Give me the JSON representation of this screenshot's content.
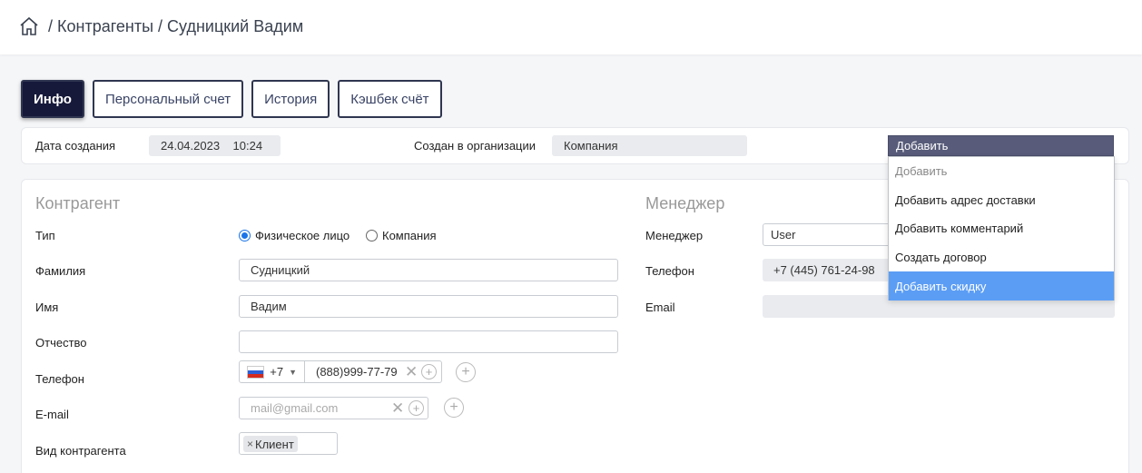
{
  "breadcrumb": {
    "sep1": " / ",
    "section": "Контрагенты",
    "sep2": " / ",
    "current": "Судницкий Вадим"
  },
  "tabs": [
    {
      "label": "Инфо"
    },
    {
      "label": "Персональный счет"
    },
    {
      "label": "История"
    },
    {
      "label": "Кэшбек счёт"
    }
  ],
  "info": {
    "created_label": "Дата создания",
    "created_value": "24.04.2023    10:24",
    "org_label": "Создан в организации",
    "org_value": "Компания"
  },
  "dropdown": {
    "selected": "Добавить",
    "options": [
      {
        "label": "Добавить"
      },
      {
        "label": "Добавить адрес доставки"
      },
      {
        "label": "Добавить комментарий"
      },
      {
        "label": "Создать договор"
      },
      {
        "label": "Добавить скидку"
      }
    ]
  },
  "contractor": {
    "title": "Контрагент",
    "type_label": "Тип",
    "type_option1": "Физическое лицо",
    "type_option2": "Компания",
    "lastname_label": "Фамилия",
    "lastname_value": "Судницкий",
    "firstname_label": "Имя",
    "firstname_value": "Вадим",
    "patronymic_label": "Отчество",
    "patronymic_value": "",
    "phone_label": "Телефон",
    "phone_code": "+7",
    "phone_value": "(888)999-77-79",
    "email_label": "E-mail",
    "email_placeholder": "mail@gmail.com",
    "kind_label": "Вид контрагента",
    "kind_tag": "Клиент"
  },
  "manager": {
    "title": "Менеджер",
    "manager_label": "Менеджер",
    "manager_value": "User",
    "phone_label": "Телефон",
    "phone_value": "+7 (445) 761-24-98",
    "email_label": "Email",
    "email_value": ""
  },
  "colors": {
    "accent": "#16193a",
    "highlight": "#5b9df5",
    "dropdown_header": "#585c7a"
  }
}
